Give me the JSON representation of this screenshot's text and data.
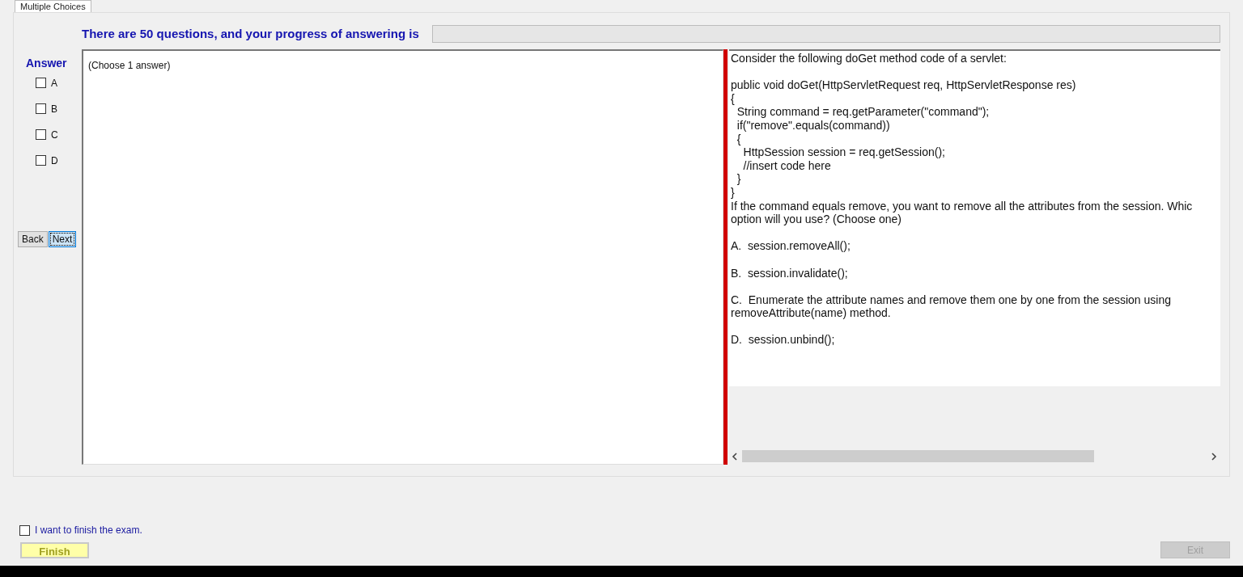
{
  "tab": {
    "label": "Multiple Choices",
    "selected": true
  },
  "header": {
    "text": "There are 50 questions, and your progress of answering is",
    "progress": {
      "level": 0
    }
  },
  "answer": {
    "title": "Answer",
    "options": [
      {
        "label": "A",
        "checked": false
      },
      {
        "label": "B",
        "checked": false
      },
      {
        "label": "C",
        "checked": false
      },
      {
        "label": "D",
        "checked": false
      }
    ]
  },
  "nav": [
    {
      "label": "Back",
      "focused": false
    },
    {
      "label": "Next",
      "focused": true
    }
  ],
  "answer_box": {
    "text": "(Choose 1 answer)"
  },
  "question": [
    [
      "Consider the following doGet method code of a servlet:"
    ],
    [
      "public void doGet(HttpServletRequest req, HttpServletResponse res)",
      "{",
      "  String command = req.getParameter(\"command\");",
      "  if(\"remove\".equals(command))",
      "  {",
      "    HttpSession session = req.getSession();",
      "    //insert code here",
      "  }",
      "}",
      "If the command equals remove, you want to remove all the attributes from the session. Whic",
      "option will you use? (Choose one)"
    ],
    [
      "A.  session.removeAll();"
    ],
    [
      "B.  session.invalidate();"
    ],
    [
      "C.  Enumerate the attribute names and remove them one by one from the session using",
      "removeAttribute(name) method."
    ],
    [
      "D.  session.unbind();"
    ]
  ],
  "finish": {
    "confirm": {
      "label": "I want to finish the exam.",
      "checked": false
    },
    "button": "Finish"
  },
  "exit": {
    "label": "Exit",
    "disabled": true
  }
}
